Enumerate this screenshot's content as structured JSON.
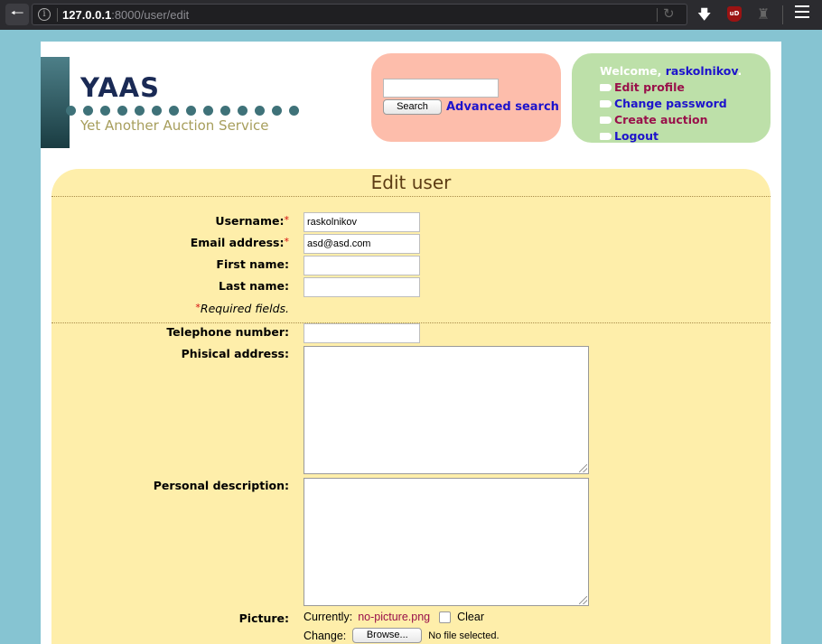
{
  "browser": {
    "url_host": "127.0.0.1",
    "url_rest": ":8000/user/edit",
    "ublock_label": "uD"
  },
  "header": {
    "logo_title": "YAAS",
    "logo_subtitle": "Yet Another Auction Service",
    "search": {
      "input_value": "",
      "button_label": "Search",
      "advanced_label": "Advanced search"
    },
    "user_menu": {
      "welcome_prefix": "Welcome, ",
      "username": "raskolnikov",
      "welcome_suffix": ".",
      "links": {
        "edit_profile": "Edit profile",
        "change_password": "Change password",
        "create_auction": "Create auction",
        "logout": "Logout"
      }
    }
  },
  "form": {
    "title": "Edit user",
    "required_marker": "*",
    "fields": {
      "username": {
        "label": "Username:",
        "value": "raskolnikov"
      },
      "email": {
        "label": "Email address:",
        "value": "asd@asd.com"
      },
      "first_name": {
        "label": "First name:",
        "value": ""
      },
      "last_name": {
        "label": "Last name:",
        "value": ""
      },
      "telephone": {
        "label": "Telephone number:",
        "value": ""
      },
      "address": {
        "label": "Phisical address:",
        "value": ""
      },
      "description": {
        "label": "Personal description:",
        "value": ""
      }
    },
    "required_note": "Required fields.",
    "picture": {
      "label": "Picture:",
      "currently_label": "Currently:",
      "current_file": "no-picture.png",
      "clear_label": "Clear",
      "change_label": "Change:",
      "browse_label": "Browse...",
      "no_file_text": "No file selected."
    }
  },
  "colors": {
    "page_bg": "#86c4d2",
    "panel_bg": "#feeeaa",
    "search_box_bg": "#fdbdab",
    "user_box_bg": "#bde0a9",
    "link_blue": "#1d13cc",
    "link_maroon": "#99104a"
  }
}
